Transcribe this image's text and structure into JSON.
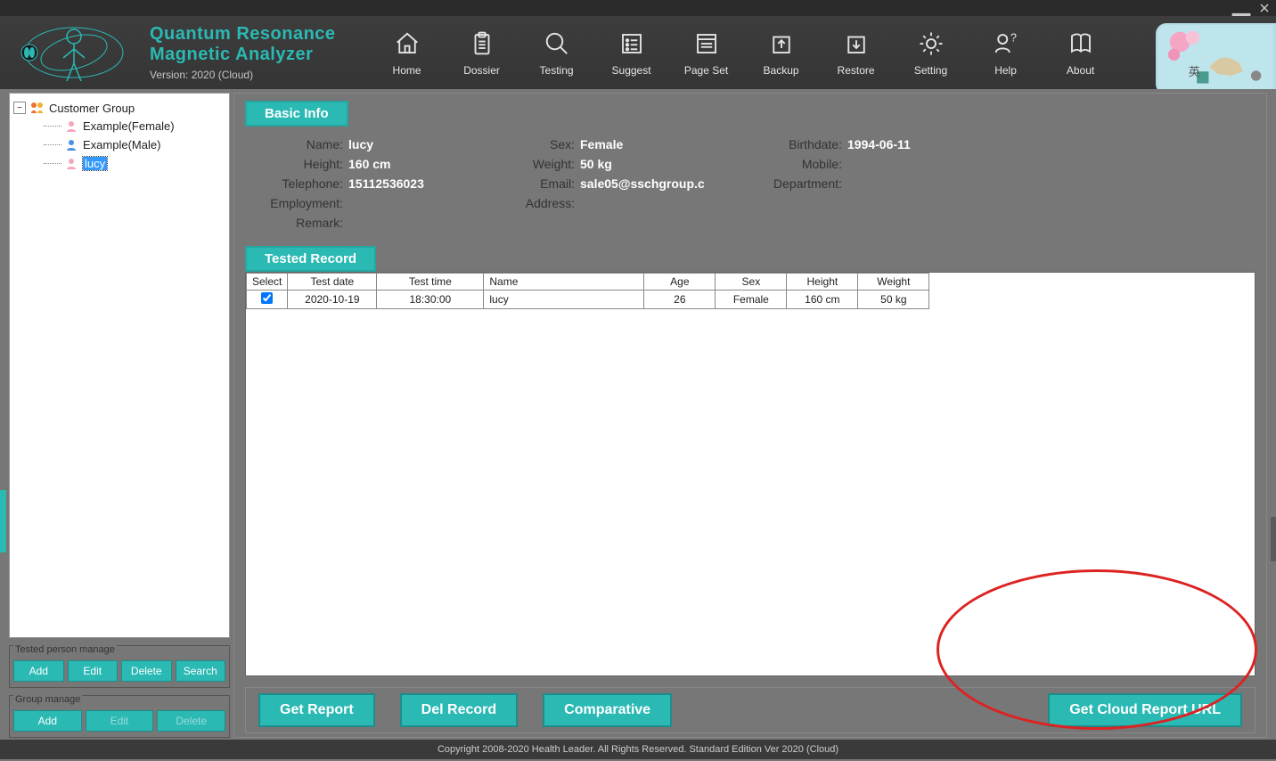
{
  "app": {
    "title_line1": "Quantum Resonance",
    "title_line2": "Magnetic Analyzer",
    "version": "Version: 2020 (Cloud)"
  },
  "toolbar": [
    {
      "id": "home",
      "label": "Home"
    },
    {
      "id": "dossier",
      "label": "Dossier"
    },
    {
      "id": "testing",
      "label": "Testing"
    },
    {
      "id": "suggest",
      "label": "Suggest"
    },
    {
      "id": "pageset",
      "label": "Page Set"
    },
    {
      "id": "backup",
      "label": "Backup"
    },
    {
      "id": "restore",
      "label": "Restore"
    },
    {
      "id": "setting",
      "label": "Setting"
    },
    {
      "id": "help",
      "label": "Help"
    },
    {
      "id": "about",
      "label": "About"
    }
  ],
  "tree": {
    "group_label": "Customer Group",
    "items": [
      {
        "label": "Example(Female)",
        "sex": "f",
        "selected": false
      },
      {
        "label": "Example(Male)",
        "sex": "m",
        "selected": false
      },
      {
        "label": "lucy",
        "sex": "f",
        "selected": true
      }
    ]
  },
  "person_manage": {
    "legend": "Tested person manage",
    "buttons": [
      "Add",
      "Edit",
      "Delete",
      "Search"
    ]
  },
  "group_manage": {
    "legend": "Group manage",
    "buttons": [
      {
        "label": "Add",
        "enabled": true
      },
      {
        "label": "Edit",
        "enabled": false
      },
      {
        "label": "Delete",
        "enabled": false
      }
    ]
  },
  "sections": {
    "basic_info": "Basic Info",
    "tested_record": "Tested Record"
  },
  "info": {
    "name_label": "Name:",
    "name": "lucy",
    "sex_label": "Sex:",
    "sex": "Female",
    "birth_label": "Birthdate:",
    "birth": "1994-06-11",
    "height_label": "Height:",
    "height": "160 cm",
    "weight_label": "Weight:",
    "weight": "50 kg",
    "mobile_label": "Mobile:",
    "mobile": "",
    "tel_label": "Telephone:",
    "tel": "15112536023",
    "email_label": "Email:",
    "email": "sale05@sschgroup.c",
    "dept_label": "Department:",
    "dept": "",
    "emp_label": "Employment:",
    "emp": "",
    "addr_label": "Address:",
    "addr": "",
    "remark_label": "Remark:",
    "remark": ""
  },
  "table": {
    "headers": [
      "Select",
      "Test date",
      "Test time",
      "Name",
      "Age",
      "Sex",
      "Height",
      "Weight"
    ],
    "rows": [
      {
        "checked": true,
        "date": "2020-10-19",
        "time": "18:30:00",
        "name": "lucy",
        "age": "26",
        "sex": "Female",
        "height": "160 cm",
        "weight": "50 kg"
      }
    ]
  },
  "actions": {
    "get_report": "Get Report",
    "del_record": "Del Record",
    "comparative": "Comparative",
    "cloud_url": "Get Cloud Report URL"
  },
  "footer": "Copyright 2008-2020 Health Leader. All Rights Reserved.  Standard Edition Ver 2020 (Cloud)"
}
